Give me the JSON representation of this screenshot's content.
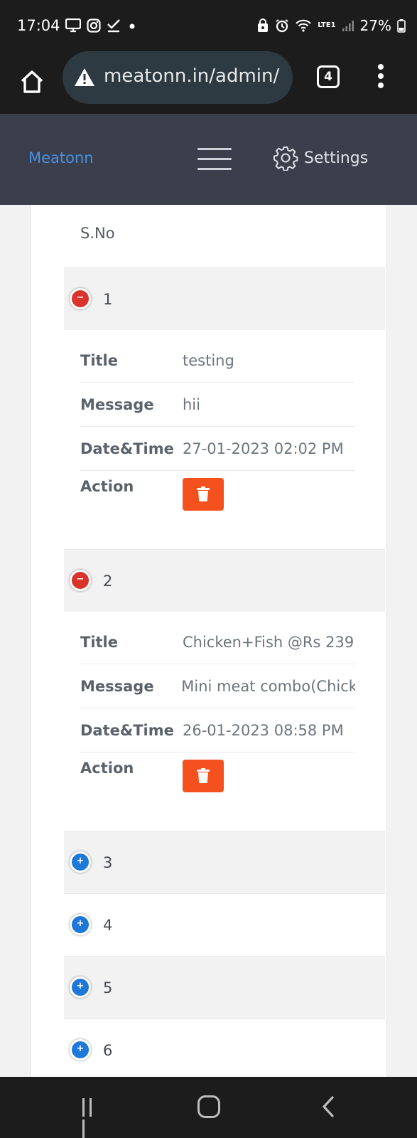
{
  "status_bar": {
    "time": "17:04",
    "battery": "27%",
    "network": "LTE1"
  },
  "browser": {
    "url": "meatonn.in/admin/",
    "tab_count": "4"
  },
  "app": {
    "brand": "Meatonn",
    "settings_label": "Settings"
  },
  "table": {
    "column_header": "S.No",
    "detail_labels": {
      "title": "Title",
      "message": "Message",
      "datetime": "Date&Time",
      "action": "Action"
    },
    "rows": [
      {
        "sno": "1",
        "expanded": true,
        "title": "testing",
        "message": "hii",
        "datetime": "27-01-2023 02:02 PM"
      },
      {
        "sno": "2",
        "expanded": true,
        "title": "Chicken+Fish @Rs 239",
        "message": "Mini meat combo(Chick",
        "datetime": "26-01-2023 08:58 PM"
      },
      {
        "sno": "3",
        "expanded": false
      },
      {
        "sno": "4",
        "expanded": false
      },
      {
        "sno": "5",
        "expanded": false
      },
      {
        "sno": "6",
        "expanded": false
      }
    ]
  },
  "colors": {
    "brand": "#4a90e2",
    "header_bg": "#3a3f4b",
    "delete_button": "#f4511e",
    "collapse_toggle": "#d9342b",
    "expand_toggle": "#1e78d8"
  },
  "icons": {
    "toggle_expanded": "−",
    "toggle_collapsed": "+"
  }
}
